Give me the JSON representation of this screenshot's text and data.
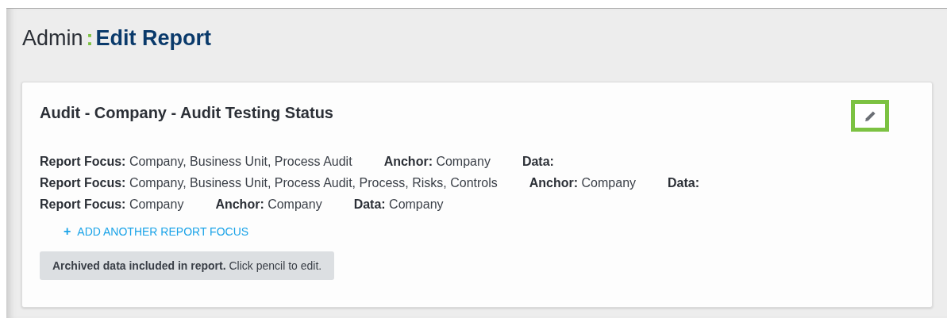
{
  "header": {
    "section": "Admin",
    "separator": ":",
    "page": "Edit Report"
  },
  "card": {
    "title": "Audit - Company - Audit Testing Status",
    "focus_rows": [
      {
        "fields": [
          "**Report Focus:** Company, Business Unit, Process Audit",
          "**Anchor:** Company",
          "**Data:**"
        ]
      },
      {
        "fields": [
          "**Report Focus:** Company, Business Unit, Process Audit, Process, Risks, Controls",
          "**Anchor:** Company",
          "**Data:**"
        ]
      },
      {
        "fields": [
          "**Report Focus:** Company",
          "**Anchor:** Company",
          "**Data:** Company"
        ]
      }
    ],
    "add_link": {
      "icon": "+",
      "label": "ADD ANOTHER REPORT FOCUS"
    },
    "note": "**Archived data included in report.** Click pencil to edit."
  }
}
